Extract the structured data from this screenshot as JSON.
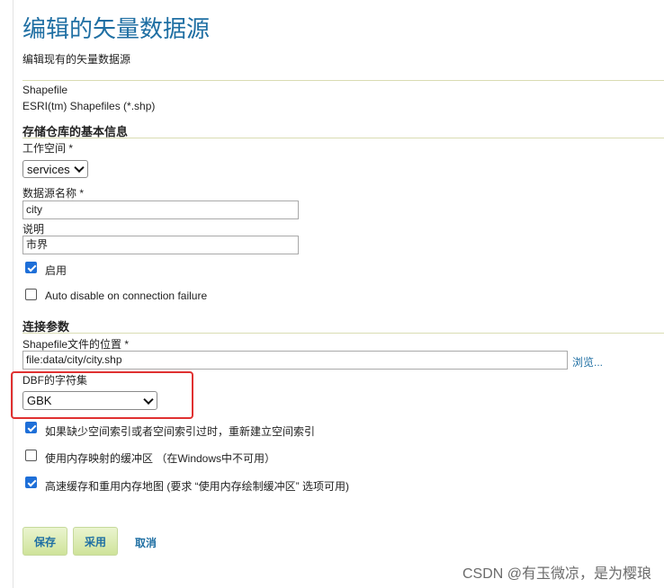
{
  "page": {
    "title": "编辑的矢量数据源",
    "description": "编辑现有的矢量数据源"
  },
  "store_type": {
    "name": "Shapefile",
    "description": "ESRI(tm) Shapefiles (*.shp)"
  },
  "basic_info": {
    "heading": "存储仓库的基本信息",
    "workspace_label": "工作空间 *",
    "workspace_value": "services",
    "datasource_name_label": "数据源名称 *",
    "datasource_name_value": "city",
    "description_label": "说明",
    "description_value": "市界",
    "enabled_label": "启用",
    "enabled_checked": true,
    "auto_disable_label": "Auto disable on connection failure",
    "auto_disable_checked": false
  },
  "connection": {
    "heading": "连接参数",
    "location_label": "Shapefile文件的位置 *",
    "location_value": "file:data/city/city.shp",
    "browse_label": "浏览...",
    "charset_label": "DBF的字符集",
    "charset_value": "GBK",
    "options": [
      {
        "label": "如果缺少空间索引或者空间索引过时，重新建立空间索引",
        "checked": true
      },
      {
        "label": "使用内存映射的缓冲区 （在Windows中不可用）",
        "checked": false
      },
      {
        "label": "高速缓存和重用内存地图 (要求 “使用内存绘制缓冲区” 选项可用)",
        "checked": true
      }
    ]
  },
  "actions": {
    "save": "保存",
    "apply": "采用",
    "cancel": "取消"
  },
  "watermark": "CSDN @有玉微凉，是为樱琅",
  "colors": {
    "heading_blue": "#1f6fa3",
    "highlight_red": "#e03131",
    "checkbox_blue": "#1e6fd8"
  }
}
